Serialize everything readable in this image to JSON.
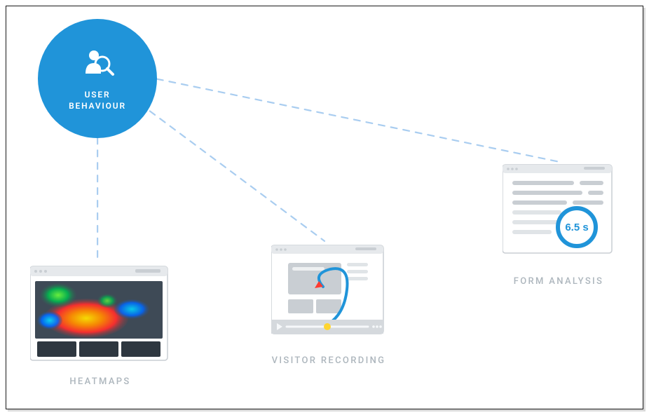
{
  "hub": {
    "label_line1": "USER",
    "label_line2": "BEHAVIOUR",
    "accent_color": "#2094d9"
  },
  "nodes": {
    "heatmaps": {
      "label": "HEATMAPS"
    },
    "visitor_recording": {
      "label": "VISITOR RECORDING"
    },
    "form_analysis": {
      "label": "FORM ANALYSIS",
      "badge_value": "6.5 s"
    }
  },
  "style": {
    "connector_color": "#a9cdf0",
    "text_muted": "#adb6bd"
  }
}
